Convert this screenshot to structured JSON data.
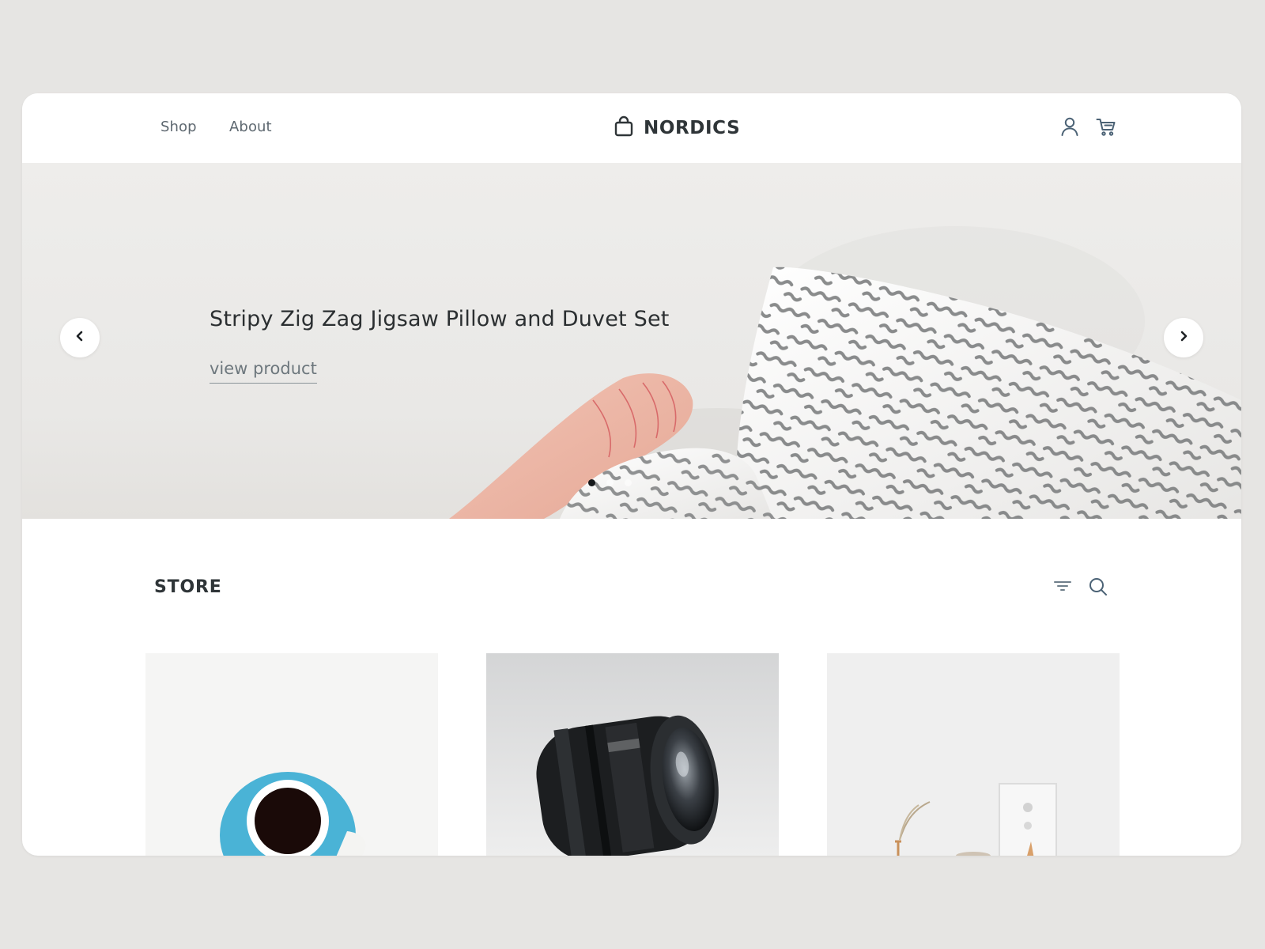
{
  "header": {
    "nav": [
      {
        "label": "Shop"
      },
      {
        "label": "About"
      }
    ],
    "brand": {
      "name": "NORDICS",
      "icon": "shopping-bag-icon"
    },
    "icons": [
      "user-icon",
      "cart-icon"
    ]
  },
  "hero": {
    "title": "Stripy Zig Zag Jigsaw Pillow and Duvet Set",
    "cta": "view product",
    "prev_icon": "chevron-left-icon",
    "next_icon": "chevron-right-icon",
    "slides_count": 3,
    "active_slide": 1
  },
  "store": {
    "title": "STORE",
    "tools": [
      "filter-icon",
      "search-icon"
    ],
    "products": [
      {
        "image": "blue-coffee-cup"
      },
      {
        "image": "camera-lens"
      },
      {
        "image": "white-shelf-decor"
      }
    ]
  },
  "colors": {
    "page_background": "#e6e5e3",
    "card_background": "#ffffff",
    "text_dark": "#2d3236",
    "text_muted": "#5e6870"
  }
}
